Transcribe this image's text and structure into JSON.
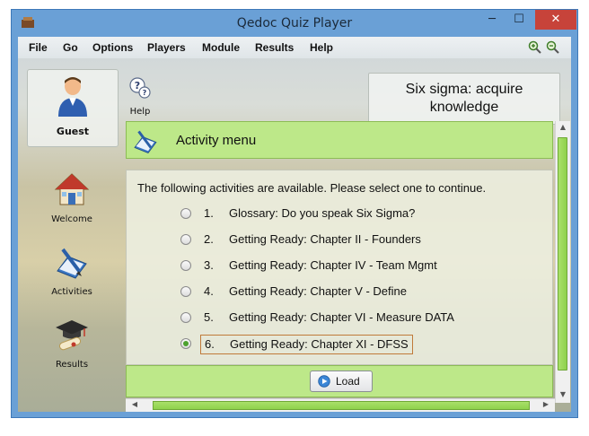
{
  "window": {
    "title": "Qedoc Quiz Player",
    "close_glyph": "✕",
    "minimize_glyph": "─",
    "maximize_glyph": "☐"
  },
  "menubar": {
    "items": [
      "File",
      "Go",
      "Options",
      "Players",
      "Module",
      "Results",
      "Help"
    ]
  },
  "user": {
    "name": "Guest"
  },
  "help": {
    "label": "Help"
  },
  "quiz_title": {
    "line1": "Six sigma: acquire",
    "line2": "knowledge"
  },
  "nav": [
    {
      "label": "Welcome",
      "icon": "house-icon"
    },
    {
      "label": "Activities",
      "icon": "book-pen-icon"
    },
    {
      "label": "Results",
      "icon": "graduation-cap-icon"
    }
  ],
  "panel": {
    "title": "Activity menu",
    "intro": "The following activities are available. Please select one to continue.",
    "activities": [
      {
        "num": "1.",
        "label": "Glossary: Do you speak Six Sigma?",
        "selected": false
      },
      {
        "num": "2.",
        "label": "Getting Ready: Chapter II - Founders",
        "selected": false
      },
      {
        "num": "3.",
        "label": "Getting Ready: Chapter IV - Team Mgmt",
        "selected": false
      },
      {
        "num": "4.",
        "label": "Getting Ready: Chapter V - Define",
        "selected": false
      },
      {
        "num": "5.",
        "label": "Getting Ready: Chapter VI - Measure DATA",
        "selected": false
      },
      {
        "num": "6.",
        "label": "Getting Ready: Chapter XI - DFSS",
        "selected": true
      }
    ],
    "load_label": "Load"
  },
  "colors": {
    "accent_green": "#bde889",
    "titlebar": "#6aa0d6",
    "close": "#c7433a"
  }
}
